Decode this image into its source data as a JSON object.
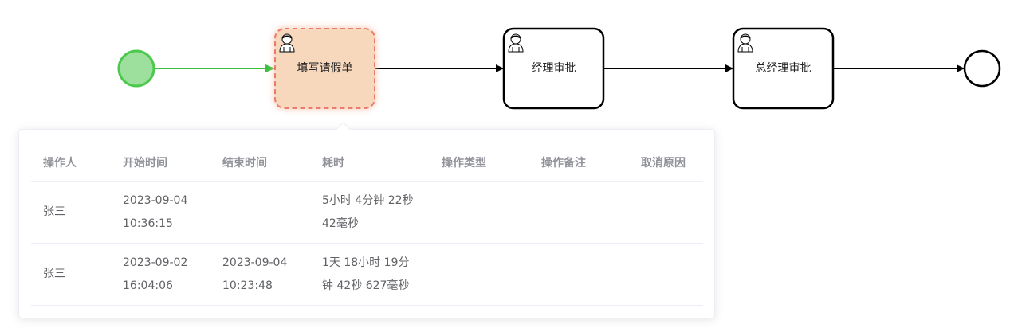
{
  "diagram": {
    "tasks": [
      {
        "label": "填写请假单",
        "state": "active",
        "icon": "user-icon"
      },
      {
        "label": "经理审批",
        "state": "pending",
        "icon": "user-icon"
      },
      {
        "label": "总经理审批",
        "state": "pending",
        "icon": "user-icon"
      }
    ],
    "start_event_color": "#4cc94c",
    "active_task_color": "#f8d8bd",
    "active_border_color": "#ec7b6a"
  },
  "history": {
    "columns": [
      "操作人",
      "开始时间",
      "结束时间",
      "耗时",
      "操作类型",
      "操作备注",
      "取消原因"
    ],
    "rows": [
      {
        "operator": "张三",
        "start": [
          "2023-09-04",
          "10:36:15"
        ],
        "end": [
          "",
          ""
        ],
        "duration": [
          "5小时 4分钟 22秒",
          "42毫秒"
        ],
        "op_type": "",
        "remark": "",
        "cancel_reason": ""
      },
      {
        "operator": "张三",
        "start": [
          "2023-09-02",
          "16:04:06"
        ],
        "end": [
          "2023-09-04",
          "10:23:48"
        ],
        "duration": [
          "1天 18小时 19分",
          "钟 42秒 627毫秒"
        ],
        "op_type": "",
        "remark": "",
        "cancel_reason": ""
      }
    ]
  }
}
